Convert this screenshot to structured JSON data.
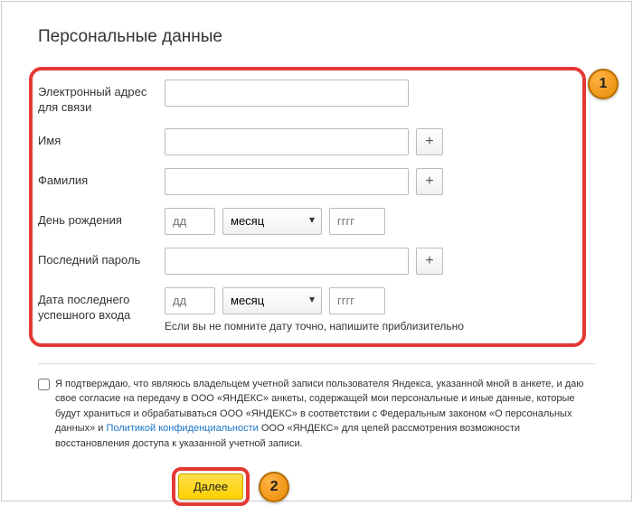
{
  "title": "Персональные данные",
  "labels": {
    "email": "Электронный адрес для связи",
    "firstname": "Имя",
    "lastname": "Фамилия",
    "birthday": "День рождения",
    "lastpass": "Последний пароль",
    "lastlogin": "Дата последнего успешного входа"
  },
  "placeholders": {
    "dd": "дд",
    "month": "месяц",
    "yyyy": "гггг"
  },
  "hint": "Если вы не помните дату точно, напишите приблизительно",
  "plus": "+",
  "consent": {
    "p1": "Я подтверждаю, что являюсь владельцем учетной записи пользователя Яндекса, указанной мной в анкете, и даю свое согласие на передачу в ООО «ЯНДЕКС» анкеты, содержащей мои персональные и иные данные, которые будут храниться и обрабатываться ООО «ЯНДЕКС» в соответствии с Федеральным законом «О персональных данных» и ",
    "link": "Политикой конфиденциальности",
    "p2": " ООО «ЯНДЕКС» для целей рассмотрения возможности восстановления доступа к указанной учетной записи."
  },
  "submit": "Далее",
  "badges": {
    "b1": "1",
    "b2": "2"
  }
}
